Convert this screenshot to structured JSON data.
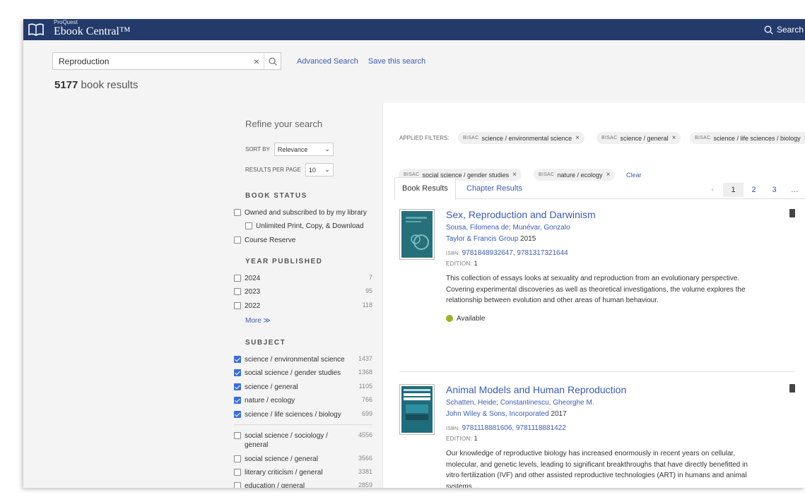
{
  "header": {
    "brand_small": "ProQuest",
    "brand_name": "Ebook Central™",
    "search_label": "Search"
  },
  "search": {
    "query": "Reproduction",
    "advanced_label": "Advanced Search",
    "save_label": "Save this search",
    "result_count": "5177",
    "result_suffix": "book results"
  },
  "refine": {
    "title": "Refine your search",
    "sort_label": "SORT BY",
    "sort_value": "Relevance",
    "rpp_label": "RESULTS PER PAGE",
    "rpp_value": "10",
    "book_status": {
      "heading": "BOOK STATUS",
      "items": [
        {
          "label": "Owned and subscribed to by my library",
          "checked": false
        },
        {
          "label": "Unlimited Print, Copy, & Download",
          "checked": false
        },
        {
          "label": "Course Reserve",
          "checked": false
        }
      ]
    },
    "year": {
      "heading": "YEAR PUBLISHED",
      "items": [
        {
          "label": "2024",
          "count": "7",
          "checked": false
        },
        {
          "label": "2023",
          "count": "95",
          "checked": false
        },
        {
          "label": "2022",
          "count": "118",
          "checked": false
        }
      ],
      "more": "More ≫"
    },
    "subject": {
      "heading": "SUBJECT",
      "items": [
        {
          "label": "science / environmental science",
          "count": "1437",
          "checked": true
        },
        {
          "label": "social science / gender studies",
          "count": "1368",
          "checked": true
        },
        {
          "label": "science / general",
          "count": "1105",
          "checked": true
        },
        {
          "label": "nature / ecology",
          "count": "766",
          "checked": true
        },
        {
          "label": "science / life sciences / biology",
          "count": "699",
          "checked": true
        },
        {
          "label": "social science / sociology / general",
          "count": "4556",
          "checked": false
        },
        {
          "label": "social science / general",
          "count": "3566",
          "checked": false
        },
        {
          "label": "literary criticism / general",
          "count": "3381",
          "checked": false
        },
        {
          "label": "education / general",
          "count": "2859",
          "checked": false
        }
      ]
    }
  },
  "filters": {
    "label": "APPLIED FILTERS:",
    "prefix": "BISAC",
    "chips": [
      "science / environmental science",
      "science / general",
      "science / life sciences / biology",
      "social science / gender studies",
      "nature / ecology"
    ],
    "clear": "Clear"
  },
  "tabs": [
    "Book Results",
    "Chapter Results"
  ],
  "pagination": {
    "prev": "‹",
    "pages": [
      "1",
      "2",
      "3"
    ],
    "ellipsis": "…",
    "current": "1"
  },
  "results": [
    {
      "title": "Sex, Reproduction and Darwinism",
      "authors": "Sousa, Filomena de; Munévar, Gonzalo",
      "publisher": "Taylor & Francis Group",
      "year": "2015",
      "isbn_label": "ISBN:",
      "isbn": "9781848932647, 9781317321644",
      "edition_label": "EDITION:",
      "edition": "1",
      "description": "This collection of essays looks at sexuality and reproduction from an evolutionary perspective. Covering experimental discoveries as well as theoretical investigations, the volume explores the relationship between evolution and other areas of human behaviour.",
      "availability": "Available",
      "availability_color": "#9bb31f",
      "cover_color": "#25707a"
    },
    {
      "title": "Animal Models and Human Reproduction",
      "authors": "Schatten, Heide; Constantinescu, Gheorghe M.",
      "publisher": "John Wiley & Sons, Incorporated",
      "year": "2017",
      "isbn_label": "ISBN:",
      "isbn": "9781118881606, 9781118881422",
      "edition_label": "EDITION:",
      "edition": "1",
      "description": "Our knowledge of reproductive biology has increased enormously in recent years on cellular, molecular, and genetic levels, leading to significant breakthroughs that have directly benefitted in vitro fertilization (IVF) and other assisted reproductive technologies (ART) in humans and animal systems. ...",
      "cover_color": "#1f6c7c"
    }
  ]
}
